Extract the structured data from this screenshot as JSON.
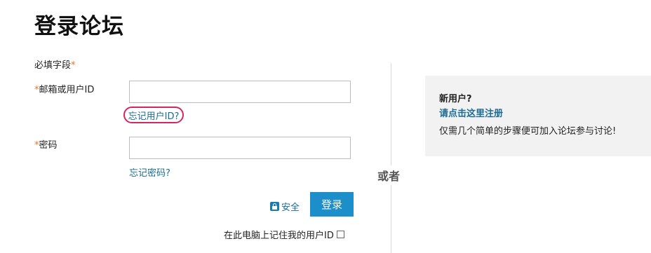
{
  "page": {
    "title": "登录论坛",
    "required_note": "必填字段",
    "required_marker": "*"
  },
  "form": {
    "username_label": "邮箱或用户ID",
    "username_value": "",
    "forgot_id": "忘记用户ID?",
    "password_label": "密码",
    "password_value": "",
    "forgot_password": "忘记密码?",
    "secure_label": "安全",
    "login_button": "登录",
    "remember_label": "在此电脑上记住我的用户ID"
  },
  "divider": {
    "or_label": "或者"
  },
  "new_user": {
    "title": "新用户?",
    "register_link": "请点击这里注册",
    "description": "仅需几个简单的步骤便可加入论坛参与讨论!"
  },
  "colors": {
    "link": "#1a6c93",
    "button": "#1c8ec9",
    "required": "#e8742d",
    "highlight_ring": "#d6265f",
    "panel_bg": "#f2f2f2"
  },
  "icons": {
    "secure": "lock-icon"
  }
}
